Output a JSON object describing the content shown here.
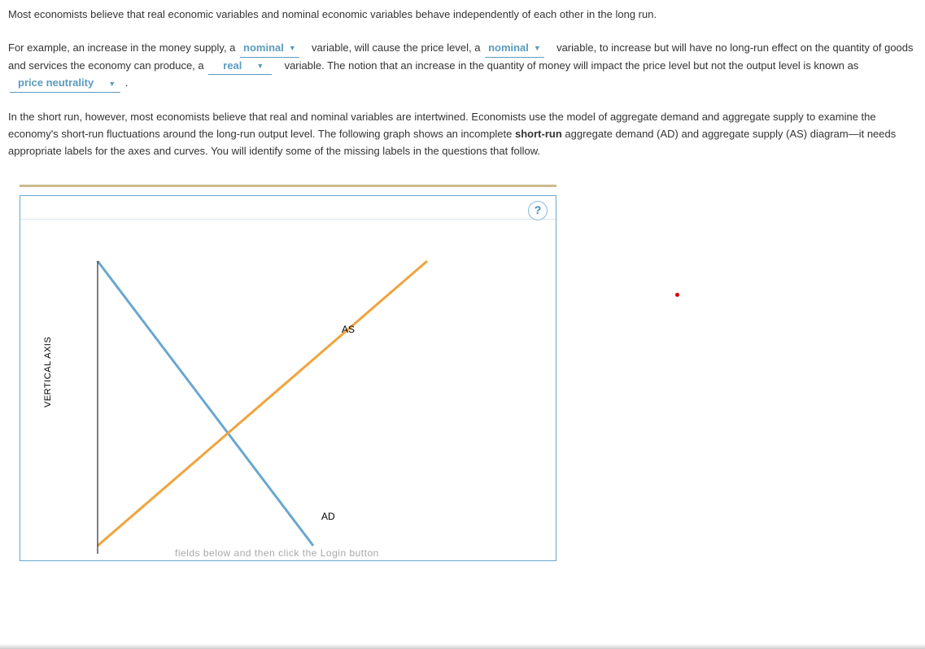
{
  "intro": "Most economists believe that real economic variables and nominal economic variables behave independently of each other in the long run.",
  "p2": {
    "t1": "For example, an increase in the money supply, a",
    "dd1": "nominal",
    "t2": " variable, will cause the price level, a",
    "dd2": "nominal",
    "t3": " variable, to increase but will have no long-run effect on the quantity of goods and services the economy can produce, a",
    "dd3": "real",
    "t4": " variable. The notion that an increase in the quantity of money will impact the price level but not the output level is known as ",
    "dd4": "price neutrality",
    "t5": " ."
  },
  "p3": {
    "t1": "In the short run, however, most economists believe that real and nominal variables are intertwined. Economists use the model of aggregate demand and aggregate supply to examine the economy's short-run fluctuations around the long-run output level. The following graph shows an incomplete ",
    "bold": "short-run",
    "t2": " aggregate demand (AD) and aggregate supply (AS) diagram—it needs appropriate labels for the axes and curves. You will identify some of the missing labels in the questions that follow."
  },
  "graph": {
    "help": "?",
    "y_axis": "VERTICAL AXIS",
    "as_label": "AS",
    "ad_label": "AD",
    "ghost": "fields below and then click the  Login  button"
  },
  "chart_data": {
    "type": "line",
    "title": "Short-run AD–AS diagram (unlabeled)",
    "xlabel": "",
    "ylabel": "VERTICAL AXIS",
    "xlim": [
      0,
      100
    ],
    "ylim": [
      0,
      100
    ],
    "series": [
      {
        "name": "AD",
        "color": "#6aa7cf",
        "x": [
          8,
          55
        ],
        "y": [
          95,
          5
        ]
      },
      {
        "name": "AS",
        "color": "#f2a33c",
        "x": [
          8,
          80
        ],
        "y": [
          5,
          95
        ]
      }
    ],
    "annotations": [
      {
        "text": "AS",
        "x": 60,
        "y": 75
      },
      {
        "text": "AD",
        "x": 54,
        "y": 14
      }
    ]
  }
}
